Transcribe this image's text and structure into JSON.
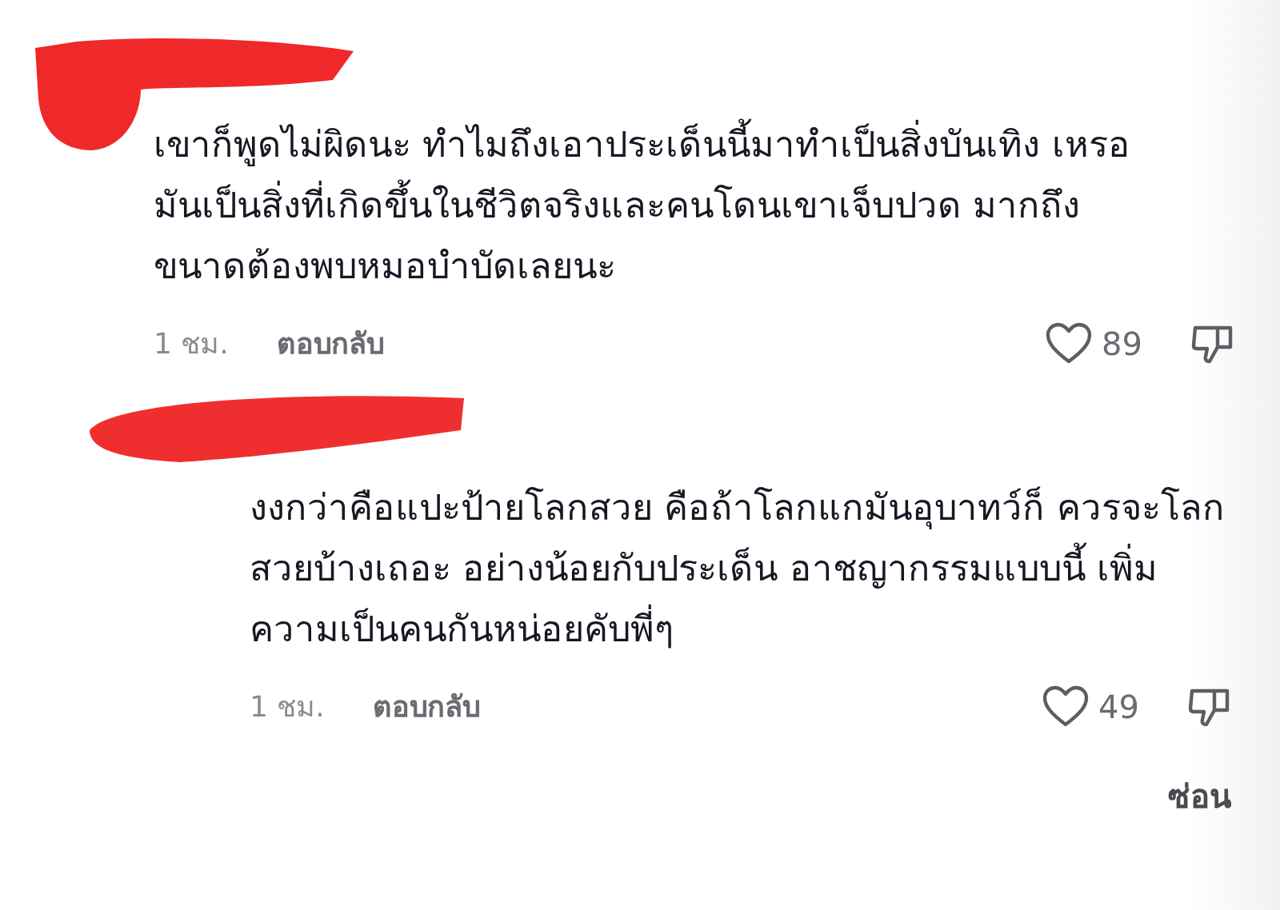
{
  "comments": [
    {
      "kind": "comment",
      "text": "เขาก็พูดไม่ผิดนะ ทำไมถึงเอาประเด็นนี้มาทำเป็นสิ่งบันเทิง เหรอ มันเป็นสิ่งที่เกิดขึ้นในชีวิตจริงและคนโดนเขาเจ็บปวด มากถึงขนาดต้องพบหมอบำบัดเลยนะ",
      "time": "1 ชม.",
      "reply": "ตอบกลับ",
      "likes": "89"
    },
    {
      "kind": "reply",
      "text": "งงกว่าคือแปะป้ายโลกสวย คือถ้าโลกแกมันอุบาทว์ก็ ควรจะโลกสวยบ้างเถอะ อย่างน้อยกับประเด็น อาชญากรรมแบบนี้ เพิ่มความเป็นคนกันหน่อยคับพี่ๆ",
      "time": "1 ชม.",
      "reply": "ตอบกลับ",
      "likes": "49"
    }
  ],
  "hide_link": "ซ่อน"
}
